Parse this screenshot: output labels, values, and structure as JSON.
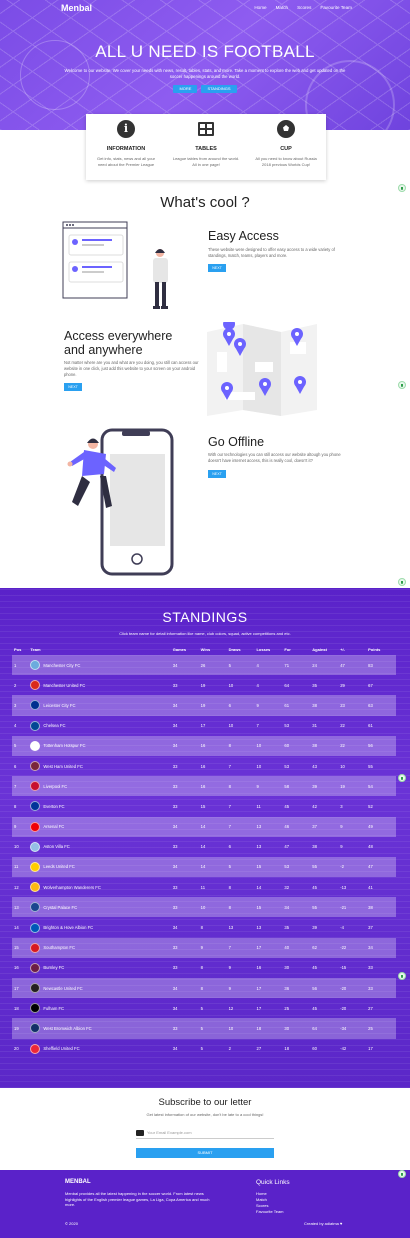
{
  "nav": {
    "brand": "Menbal",
    "links": [
      "Home",
      "Match",
      "Scores",
      "Favourite Team"
    ]
  },
  "hero": {
    "title": "ALL U NEED IS FOOTBALL",
    "subtitle": "Welcome to our website. We cover your needs with news, result, tables, stats, and more. Take a moment to explore the web and get updated on the soccer happenings around the world.",
    "btn_more": "MORE",
    "btn_standings": "STANDINGS"
  },
  "cards": [
    {
      "icon": "info-icon",
      "title": "INFORMATION",
      "text": "Get info, stats, news and all your need about the Premier League"
    },
    {
      "icon": "table-icon",
      "title": "TABLES",
      "text": "League tables from around the world. All in one page!"
    },
    {
      "icon": "ball-icon",
      "title": "CUP",
      "text": "All you need to know about Russia 2018 previous Worlds Cup!"
    }
  ],
  "whats_cool": "What's cool ?",
  "features": [
    {
      "title": "Easy Access",
      "text": "These website were designed to offer easy access to a wide variety of standings, match, teams, players and more.",
      "btn": "NEXT"
    },
    {
      "title": "Access everywhere and anywhere",
      "text": "Not matter where are you and what are you doing, you still can access our website in one click, just add this website to your screen on your android phone.",
      "btn": "NEXT"
    },
    {
      "title": "Go Offline",
      "text": "With our technologies you can still access our website altough you phone doesn't have internet access, this is really cool, doesn't it?",
      "btn": "NEXT"
    }
  ],
  "standings": {
    "title": "STANDINGS",
    "subtitle": "Click team name for detail information like name, club colors, squad, active competitions and etc.",
    "headers": [
      "Pos",
      "Team",
      "Games",
      "Wins",
      "Draws",
      "Losses",
      "For",
      "Against",
      "+/-",
      "Points"
    ],
    "rows": [
      {
        "pos": "1",
        "team": "Manchester City FC",
        "color": "#6cabdd",
        "games": "34",
        "wins": "26",
        "draws": "5",
        "losses": "4",
        "for": "71",
        "against": "24",
        "diff": "47",
        "points": "83"
      },
      {
        "pos": "2",
        "team": "Manchester United FC",
        "color": "#da291c",
        "games": "33",
        "wins": "19",
        "draws": "10",
        "losses": "4",
        "for": "64",
        "against": "35",
        "diff": "29",
        "points": "67"
      },
      {
        "pos": "3",
        "team": "Leicester City FC",
        "color": "#003090",
        "games": "34",
        "wins": "19",
        "draws": "6",
        "losses": "9",
        "for": "61",
        "against": "38",
        "diff": "23",
        "points": "63"
      },
      {
        "pos": "4",
        "team": "Chelsea FC",
        "color": "#034694",
        "games": "34",
        "wins": "17",
        "draws": "10",
        "losses": "7",
        "for": "53",
        "against": "31",
        "diff": "22",
        "points": "61"
      },
      {
        "pos": "5",
        "team": "Tottenham Hotspur FC",
        "color": "#ffffff",
        "games": "34",
        "wins": "16",
        "draws": "8",
        "losses": "10",
        "for": "60",
        "against": "38",
        "diff": "22",
        "points": "56"
      },
      {
        "pos": "6",
        "team": "West Ham United FC",
        "color": "#7a263a",
        "games": "33",
        "wins": "16",
        "draws": "7",
        "losses": "10",
        "for": "53",
        "against": "43",
        "diff": "10",
        "points": "55"
      },
      {
        "pos": "7",
        "team": "Liverpool FC",
        "color": "#c8102e",
        "games": "33",
        "wins": "16",
        "draws": "8",
        "losses": "9",
        "for": "58",
        "against": "39",
        "diff": "19",
        "points": "54"
      },
      {
        "pos": "8",
        "team": "Everton FC",
        "color": "#003399",
        "games": "33",
        "wins": "15",
        "draws": "7",
        "losses": "11",
        "for": "45",
        "against": "42",
        "diff": "3",
        "points": "52"
      },
      {
        "pos": "9",
        "team": "Arsenal FC",
        "color": "#ef0107",
        "games": "34",
        "wins": "14",
        "draws": "7",
        "losses": "13",
        "for": "46",
        "against": "37",
        "diff": "9",
        "points": "49"
      },
      {
        "pos": "10",
        "team": "Aston Villa FC",
        "color": "#95bfe5",
        "games": "33",
        "wins": "14",
        "draws": "6",
        "losses": "13",
        "for": "47",
        "against": "38",
        "diff": "9",
        "points": "48"
      },
      {
        "pos": "11",
        "team": "Leeds United FC",
        "color": "#ffcd00",
        "games": "34",
        "wins": "14",
        "draws": "5",
        "losses": "15",
        "for": "53",
        "against": "55",
        "diff": "-2",
        "points": "47"
      },
      {
        "pos": "12",
        "team": "Wolverhampton Wanderers FC",
        "color": "#fdb913",
        "games": "33",
        "wins": "11",
        "draws": "8",
        "losses": "14",
        "for": "32",
        "against": "45",
        "diff": "-13",
        "points": "41"
      },
      {
        "pos": "13",
        "team": "Crystal Palace FC",
        "color": "#1b458f",
        "games": "33",
        "wins": "10",
        "draws": "8",
        "losses": "15",
        "for": "34",
        "against": "55",
        "diff": "-21",
        "points": "38"
      },
      {
        "pos": "14",
        "team": "Brighton & Hove Albion FC",
        "color": "#0057b8",
        "games": "34",
        "wins": "8",
        "draws": "13",
        "losses": "13",
        "for": "35",
        "against": "39",
        "diff": "-4",
        "points": "37"
      },
      {
        "pos": "15",
        "team": "Southampton FC",
        "color": "#d71920",
        "games": "33",
        "wins": "9",
        "draws": "7",
        "losses": "17",
        "for": "40",
        "against": "62",
        "diff": "-22",
        "points": "34"
      },
      {
        "pos": "16",
        "team": "Burnley FC",
        "color": "#6c1d45",
        "games": "33",
        "wins": "8",
        "draws": "9",
        "losses": "16",
        "for": "30",
        "against": "45",
        "diff": "-15",
        "points": "33"
      },
      {
        "pos": "17",
        "team": "Newcastle United FC",
        "color": "#241f20",
        "games": "34",
        "wins": "8",
        "draws": "9",
        "losses": "17",
        "for": "36",
        "against": "56",
        "diff": "-20",
        "points": "33"
      },
      {
        "pos": "18",
        "team": "Fulham FC",
        "color": "#000000",
        "games": "34",
        "wins": "5",
        "draws": "12",
        "losses": "17",
        "for": "25",
        "against": "45",
        "diff": "-20",
        "points": "27"
      },
      {
        "pos": "19",
        "team": "West Bromwich Albion FC",
        "color": "#122f67",
        "games": "33",
        "wins": "5",
        "draws": "10",
        "losses": "18",
        "for": "30",
        "against": "64",
        "diff": "-34",
        "points": "25"
      },
      {
        "pos": "20",
        "team": "Sheffield United FC",
        "color": "#ee2737",
        "games": "34",
        "wins": "5",
        "draws": "2",
        "losses": "27",
        "for": "18",
        "against": "60",
        "diff": "-42",
        "points": "17"
      }
    ]
  },
  "subscribe": {
    "title": "Subscribe to our letter",
    "text": "Get latest information of our website, don't be late to a cool things!",
    "placeholder": "Your Email Example.com",
    "button": "SUBMIT"
  },
  "footer": {
    "brand": "MENBAL",
    "desc": "Menbal provides all the latest happening in the soccer world. From latest news highlights of the English premier league games, La Liga, Copa America and much more.",
    "quick_title": "Quick Links",
    "quick_links": [
      "Home",
      "Match",
      "Scores",
      "Favourite Team"
    ],
    "copyright": "© 2020",
    "credit": "Created by adiatma ♥"
  },
  "colors": {
    "primary": "#5a22c9",
    "accent": "#2aa0f0",
    "hero": "#7b4ce6"
  }
}
